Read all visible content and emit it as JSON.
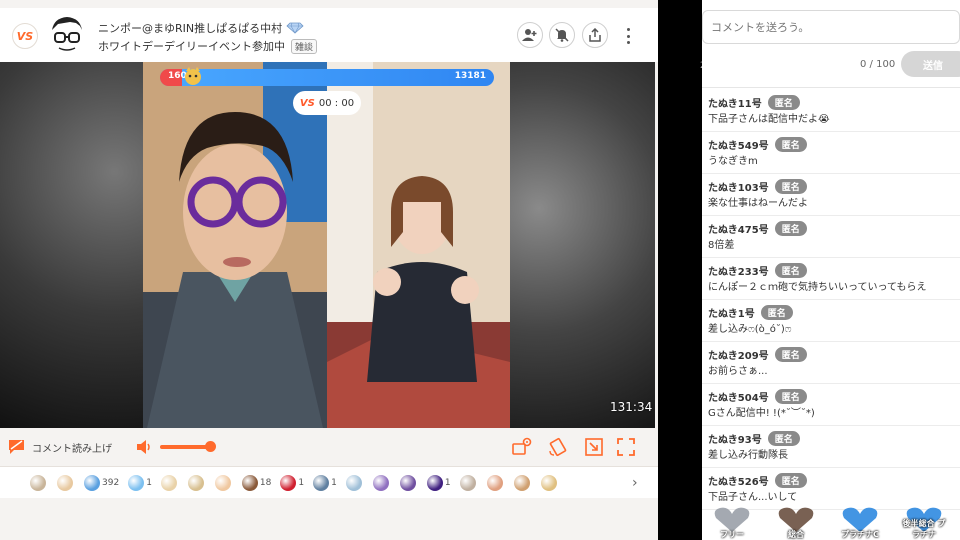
{
  "header": {
    "logo_text": "VS",
    "streamer_title": "ニンポー@まゆRIN推しぱるぱる中村",
    "subtitle": "ホワイトデーデイリーイベント参加中",
    "tag": "雑談"
  },
  "video": {
    "level": "160",
    "score": "13181",
    "vs_label": "VS",
    "vs_timer": "00 : 00",
    "duration": "131:34"
  },
  "controls": {
    "tts_label": "コメント読み上げ"
  },
  "gifts": [
    {
      "count": "",
      "color": "#c9b59a"
    },
    {
      "count": "",
      "color": "#e8c9a0"
    },
    {
      "count": "392",
      "color": "#5aa0e0"
    },
    {
      "count": "1",
      "color": "#7cc0f0"
    },
    {
      "count": "",
      "color": "#e9d2a8"
    },
    {
      "count": "",
      "color": "#d8c090"
    },
    {
      "count": "",
      "color": "#f0c8a0"
    },
    {
      "count": "18",
      "color": "#8a5a3a"
    },
    {
      "count": "1",
      "color": "#d02030"
    },
    {
      "count": "1",
      "color": "#6080a0"
    },
    {
      "count": "",
      "color": "#a0c0d8"
    },
    {
      "count": "",
      "color": "#9070c0"
    },
    {
      "count": "",
      "color": "#7050a0"
    },
    {
      "count": "1",
      "color": "#402080"
    },
    {
      "count": "",
      "color": "#c0b0a0"
    },
    {
      "count": "",
      "color": "#e0a080"
    },
    {
      "count": "",
      "color": "#d0a070"
    },
    {
      "count": "",
      "color": "#e0c080"
    }
  ],
  "comment_box": {
    "placeholder": "コメントを送ろう。",
    "counter": "0 / 100",
    "send_label": "送信",
    "side_number": "2"
  },
  "comments": [
    {
      "user": "たぬき11号",
      "badge": "匿名",
      "text": "下品子さんは配信中だよ😭"
    },
    {
      "user": "たぬき549号",
      "badge": "匿名",
      "text": "うなぎきm"
    },
    {
      "user": "たぬき103号",
      "badge": "匿名",
      "text": "楽な仕事はねーんだよ"
    },
    {
      "user": "たぬき475号",
      "badge": "匿名",
      "text": "8倍差"
    },
    {
      "user": "たぬき233号",
      "badge": "匿名",
      "text": "にんぽー２ｃｍ砲で気持ちいいっていってもらえ"
    },
    {
      "user": "たぬき1号",
      "badge": "匿名",
      "text": "差し込みෆ(ò_ó˘)ෆ"
    },
    {
      "user": "たぬき209号",
      "badge": "匿名",
      "text": "お前らさぁ..."
    },
    {
      "user": "たぬき504号",
      "badge": "匿名",
      "text": "Gさん配信中! !(*˘︶˘*)"
    },
    {
      "user": "たぬき93号",
      "badge": "匿名",
      "text": "差し込み行動隊長"
    },
    {
      "user": "たぬき526号",
      "badge": "匿名",
      "text": "下品子さん...いして"
    }
  ],
  "badges": [
    {
      "label": "フリー",
      "color": "#9aa0a8"
    },
    {
      "label": "総合",
      "color": "#6a5040"
    },
    {
      "label": "プラチナC",
      "color": "#2f8ae0"
    },
    {
      "label": "後半総合 プラチナ",
      "color": "#2f8ae0"
    }
  ]
}
